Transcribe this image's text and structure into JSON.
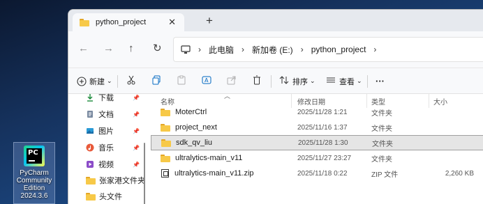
{
  "desktop": {
    "icon_label_lines": [
      "PyCharm",
      "Community",
      "Edition",
      "2024.3.6"
    ],
    "icon_logo_text": "PC"
  },
  "tab": {
    "title": "python_project",
    "close_glyph": "✕",
    "add_glyph": "+"
  },
  "nav": {
    "back": "←",
    "forward": "→",
    "up": "↑",
    "refresh": "↻"
  },
  "address": {
    "separator": "›",
    "segments": [
      "此电脑",
      "新加卷 (E:)",
      "python_project"
    ]
  },
  "commands": {
    "new_label": "新建",
    "sort_label": "排序",
    "view_label": "查看",
    "more": "···",
    "chevron": "⌄"
  },
  "sidebar": {
    "items": [
      {
        "label": "下载",
        "icon": "download-icon",
        "pinned": true
      },
      {
        "label": "文档",
        "icon": "document-icon",
        "pinned": true
      },
      {
        "label": "图片",
        "icon": "picture-icon",
        "pinned": true
      },
      {
        "label": "音乐",
        "icon": "music-icon",
        "pinned": true
      },
      {
        "label": "视频",
        "icon": "video-icon",
        "pinned": true
      },
      {
        "label": "张家港文件夹",
        "icon": "folder-icon",
        "pinned": false
      },
      {
        "label": "头文件",
        "icon": "folder-icon",
        "pinned": false
      }
    ]
  },
  "columns": {
    "name": "名称",
    "modified": "修改日期",
    "type": "类型",
    "size": "大小"
  },
  "files": [
    {
      "name": "MoterCtrl",
      "modified": "2025/11/28 1:21",
      "type": "文件夹",
      "size": "",
      "kind": "folder",
      "selected": false
    },
    {
      "name": "project_next",
      "modified": "2025/11/16 1:37",
      "type": "文件夹",
      "size": "",
      "kind": "folder",
      "selected": false
    },
    {
      "name": "sdk_qv_liu",
      "modified": "2025/11/28 1:30",
      "type": "文件夹",
      "size": "",
      "kind": "folder",
      "selected": true
    },
    {
      "name": "ultralytics-main_v11",
      "modified": "2025/11/27 23:27",
      "type": "文件夹",
      "size": "",
      "kind": "folder",
      "selected": false
    },
    {
      "name": "ultralytics-main_v11.zip",
      "modified": "2025/11/18 0:22",
      "type": "ZIP 文件",
      "size": "2,260 KB",
      "kind": "zip",
      "selected": false
    }
  ],
  "colors": {
    "folder": "#f7c948",
    "selection": "#e5e5e5",
    "accent": "#0067c0"
  }
}
